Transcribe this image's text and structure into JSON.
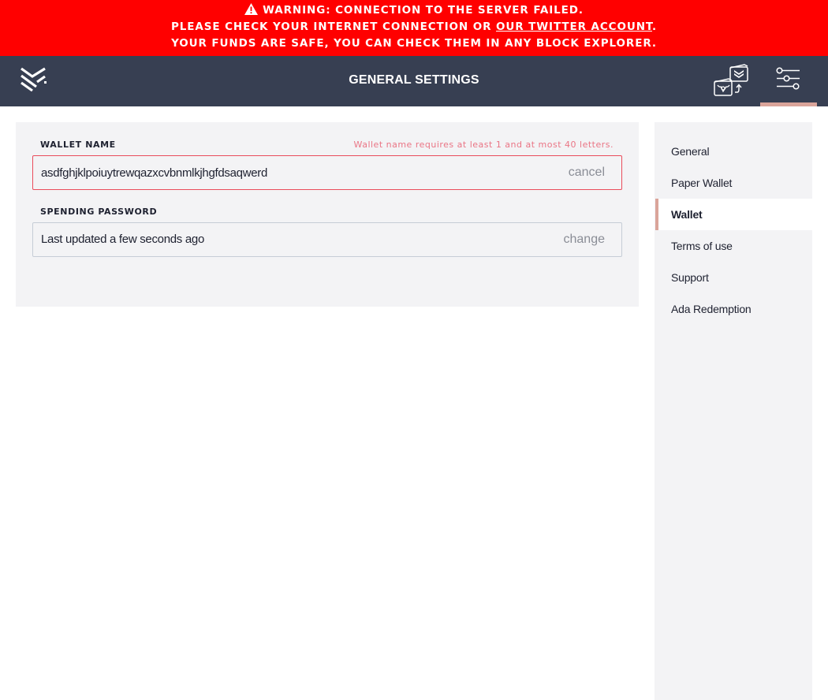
{
  "warning": {
    "icon": "warning-triangle-icon",
    "line1": "WARNING: CONNECTION TO THE SERVER FAILED.",
    "line2_prefix": "PLEASE CHECK YOUR INTERNET CONNECTION OR ",
    "line2_link": "OUR TWITTER ACCOUNT",
    "line2_suffix": ".",
    "line3": "YOUR FUNDS ARE SAFE, YOU CAN CHECK THEM IN ANY BLOCK EXPLORER.",
    "background_color": "#ff0000"
  },
  "topbar": {
    "title": "GENERAL SETTINGS",
    "logo_icon": "daedalus-logo-icon",
    "wallet_transfer_icon": "wallet-transfer-icon",
    "settings_icon": "settings-sliders-icon",
    "background_color": "#373f52",
    "active_indicator_color": "#daa49a"
  },
  "wallet_settings": {
    "wallet_name": {
      "label": "WALLET NAME",
      "value": "asdfghjklpoiuytrewqazxcvbnmlkjhgfdsaqwerd",
      "error": "Wallet name requires at least 1 and at most 40 letters.",
      "action": "cancel"
    },
    "spending_password": {
      "label": "SPENDING PASSWORD",
      "value": "Last updated a few seconds ago",
      "action": "change"
    }
  },
  "side_menu": {
    "items": [
      {
        "label": "General",
        "active": false
      },
      {
        "label": "Paper Wallet",
        "active": false
      },
      {
        "label": "Wallet",
        "active": true
      },
      {
        "label": "Terms of use",
        "active": false
      },
      {
        "label": "Support",
        "active": false
      },
      {
        "label": "Ada Redemption",
        "active": false
      }
    ]
  }
}
